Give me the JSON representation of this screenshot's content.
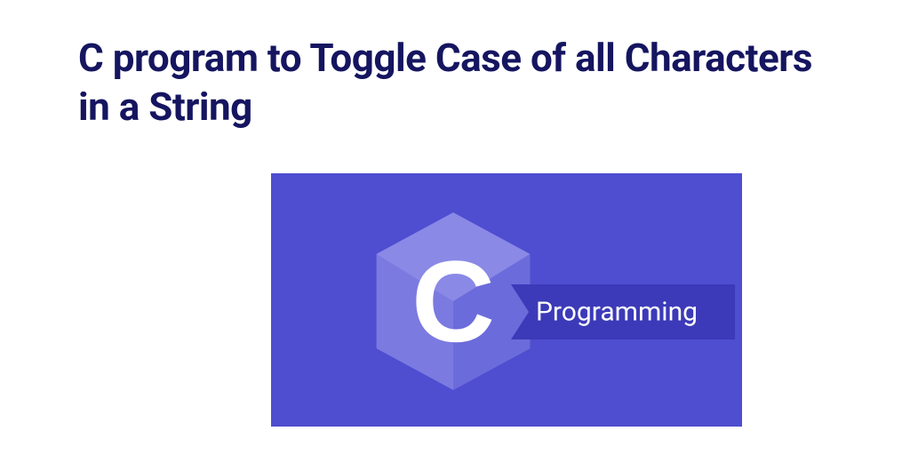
{
  "heading": "C program to Toggle Case of all Characters in a String",
  "logo": {
    "letter": "C",
    "label": "Programming",
    "colors": {
      "background": "#4f4dd0",
      "hexagon_light": "#7b7ae0",
      "hexagon_dark": "#5f5dd8",
      "banner": "#3c3ab8",
      "text": "#ffffff"
    }
  }
}
